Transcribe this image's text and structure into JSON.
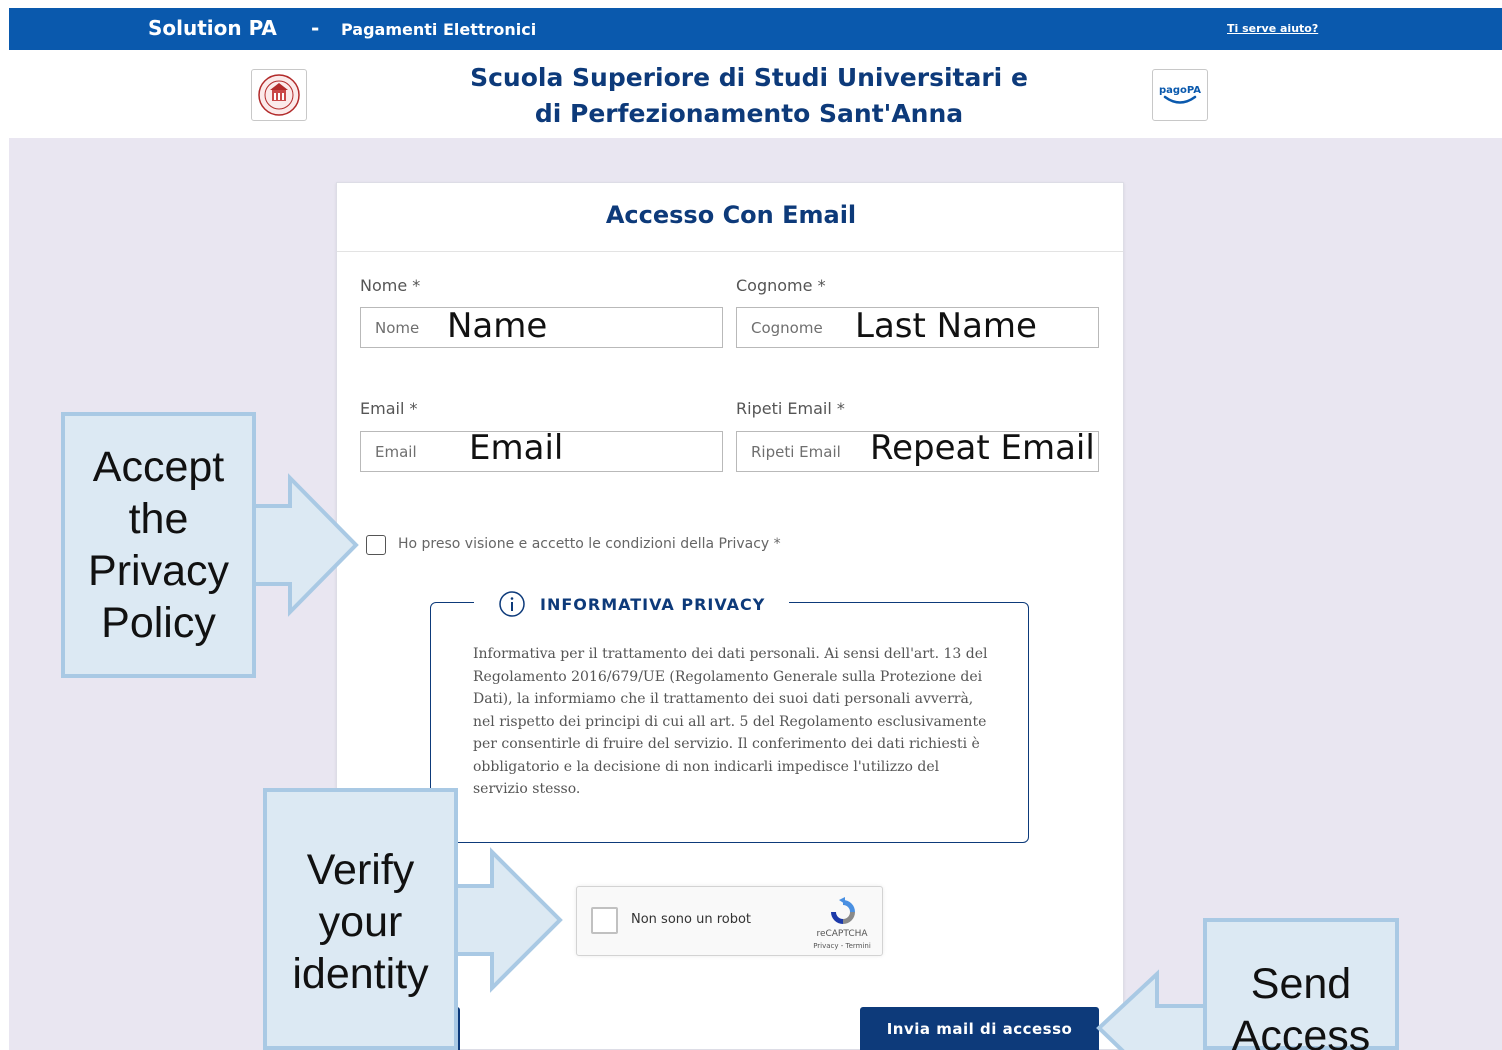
{
  "topbar": {
    "brand": "Solution PA",
    "separator": "-",
    "subtitle": "Pagamenti Elettronici",
    "help_link": "Ti serve aiuto?"
  },
  "header": {
    "school_name_line1": "Scuola Superiore di Studi Universitari e",
    "school_name_line2": "di Perfezionamento Sant'Anna",
    "left_logo": "university-seal-icon",
    "right_logo": "pagopa-logo-icon",
    "right_logo_text": "pagoPA"
  },
  "form": {
    "title": "Accesso Con Email",
    "fields": {
      "nome": {
        "label": "Nome *",
        "placeholder": "Nome",
        "annotation": "Name"
      },
      "cognome": {
        "label": "Cognome *",
        "placeholder": "Cognome",
        "annotation": "Last Name"
      },
      "email": {
        "label": "Email *",
        "placeholder": "Email",
        "annotation": "Email"
      },
      "ripeti_email": {
        "label": "Ripeti Email *",
        "placeholder": "Ripeti Email",
        "annotation": "Repeat Email"
      }
    },
    "privacy_checkbox_label": "Ho preso visione e accetto le condizioni della Privacy *",
    "privacy_box": {
      "title": "INFORMATIVA PRIVACY",
      "text": "Informativa per il trattamento dei dati personali. Ai sensi dell'art. 13 del Regolamento 2016/679/UE (Regolamento Generale sulla Protezione dei Dati), la informiamo che il trattamento dei suoi dati personali avverrà, nel rispetto dei principi di cui all art. 5 del Regolamento esclusivamente per consentirle di fruire del servizio. Il conferimento dei dati richiesti è obbligatorio e la decisione di non indicarli impedisce l'utilizzo del servizio stesso."
    },
    "recaptcha": {
      "label": "Non sono un robot",
      "brand": "reCAPTCHA",
      "links": "Privacy - Termini"
    },
    "submit_label": "Invia mail di accesso"
  },
  "callouts": {
    "privacy": "Accept the Privacy Policy",
    "identity": "Verify your identity",
    "send": "Send Access"
  },
  "colors": {
    "topbar": "#0a59ad",
    "brand_dark": "#0d3a7a",
    "page_bg": "#e9e6f1",
    "callout_fill": "#dce9f3",
    "callout_border": "#a9c9e4"
  }
}
